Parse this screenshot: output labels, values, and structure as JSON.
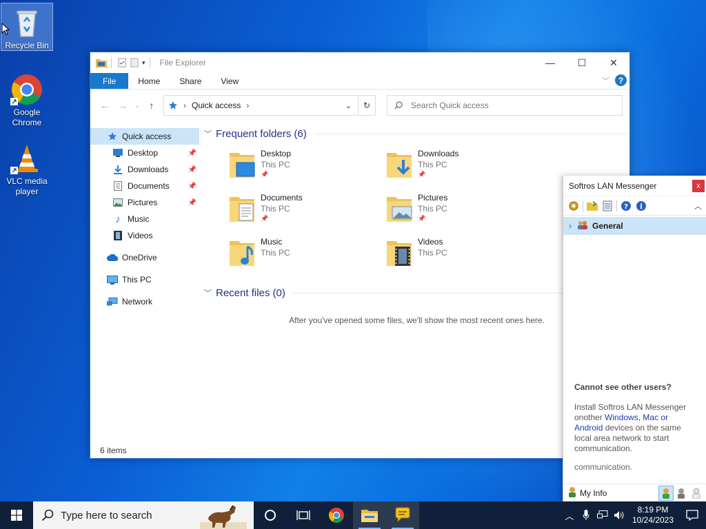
{
  "desktop": {
    "icons": [
      {
        "label": "Recycle Bin"
      },
      {
        "label": "Google Chrome"
      },
      {
        "label": "VLC media player"
      }
    ]
  },
  "explorer": {
    "title": "File Explorer",
    "ribbon": {
      "file": "File",
      "home": "Home",
      "share": "Share",
      "view": "View"
    },
    "address": {
      "crumb": "Quick access"
    },
    "search": {
      "placeholder": "Search Quick access"
    },
    "nav": [
      {
        "label": "Quick access",
        "pinned": false
      },
      {
        "label": "Desktop",
        "pinned": true
      },
      {
        "label": "Downloads",
        "pinned": true
      },
      {
        "label": "Documents",
        "pinned": true
      },
      {
        "label": "Pictures",
        "pinned": true
      },
      {
        "label": "Music",
        "pinned": false
      },
      {
        "label": "Videos",
        "pinned": false
      },
      {
        "label": "OneDrive",
        "pinned": false
      },
      {
        "label": "This PC",
        "pinned": false
      },
      {
        "label": "Network",
        "pinned": false
      }
    ],
    "frequent": {
      "header": "Frequent folders (6)",
      "folders": [
        {
          "name": "Desktop",
          "location": "This PC"
        },
        {
          "name": "Downloads",
          "location": "This PC"
        },
        {
          "name": "Documents",
          "location": "This PC"
        },
        {
          "name": "Pictures",
          "location": "This PC"
        },
        {
          "name": "Music",
          "location": "This PC"
        },
        {
          "name": "Videos",
          "location": "This PC"
        }
      ]
    },
    "recent": {
      "header": "Recent files (0)",
      "empty": "After you've opened some files, we'll show the most recent ones here."
    },
    "status": "6 items"
  },
  "messenger": {
    "title": "Softros LAN Messenger",
    "close": "x",
    "group": "General",
    "info": {
      "heading": "Cannot see other users?",
      "line1": "Install Softros LAN Messenger onother ",
      "link": "Windows, Mac or Android",
      "line2": " devices on the same local area network to start communication.",
      "ghost": "communication."
    },
    "myinfo": "My Info"
  },
  "taskbar": {
    "search_placeholder": "Type here to search",
    "time": "8:19 PM",
    "date": "10/24/2023"
  }
}
